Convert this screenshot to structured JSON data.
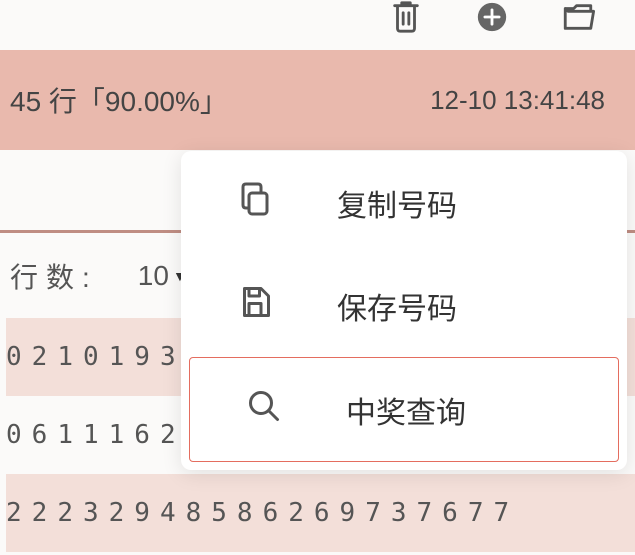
{
  "toolbar": {
    "icons": [
      "trash-icon",
      "add-circle-icon",
      "folder-icon"
    ]
  },
  "banner": {
    "status": "45 行「90.00%」",
    "timestamp": "12-10 13:41:48"
  },
  "controls": {
    "rows_label": "行数:",
    "rows_value": "10"
  },
  "grid": {
    "rows": [
      [
        "02",
        "10",
        "19",
        "33"
      ],
      [
        "06",
        "11",
        "16",
        "26"
      ],
      [
        "22",
        "23",
        "29",
        "48",
        "58",
        "62",
        "69",
        "73",
        "76",
        "77"
      ]
    ]
  },
  "menu": {
    "items": [
      {
        "icon": "copy-icon",
        "label": "复制号码"
      },
      {
        "icon": "save-icon",
        "label": "保存号码"
      },
      {
        "icon": "search-icon",
        "label": "中奖查询",
        "selected": true
      }
    ]
  }
}
